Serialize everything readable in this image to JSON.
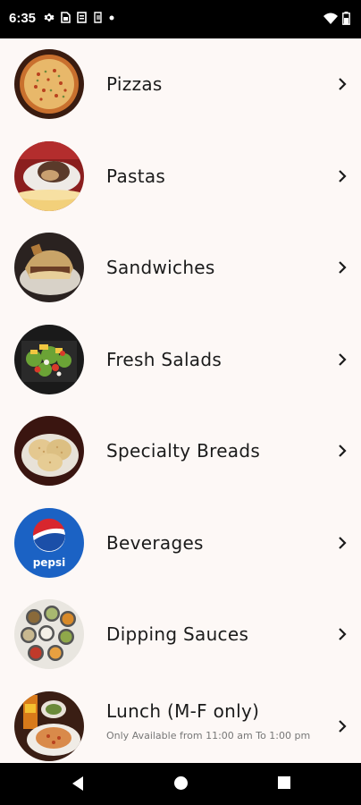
{
  "status_bar": {
    "time": "6:35",
    "left_icons": [
      "settings-icon",
      "sim-icon",
      "clipboard-icon",
      "data-icon",
      "dot-icon"
    ],
    "right_icons": [
      "wifi-icon",
      "battery-icon"
    ]
  },
  "menu": {
    "items": [
      {
        "label": "Pizzas",
        "image": "pizza-image"
      },
      {
        "label": "Pastas",
        "image": "pasta-image"
      },
      {
        "label": "Sandwiches",
        "image": "sandwich-image"
      },
      {
        "label": "Fresh Salads",
        "image": "salad-image"
      },
      {
        "label": "Specialty Breads",
        "image": "bread-image"
      },
      {
        "label": "Beverages",
        "image": "pepsi-logo-image"
      },
      {
        "label": "Dipping Sauces",
        "image": "sauces-image"
      },
      {
        "label": "Lunch (M-F only)",
        "subtitle": "Only Available from 11:00 am To 1:00 pm",
        "image": "lunch-image"
      }
    ]
  },
  "pepsi_logo_text": "pepsi",
  "nav_bar": {
    "buttons": [
      "back-icon",
      "home-icon",
      "recents-icon"
    ]
  },
  "colors": {
    "background": "#fdf8f6",
    "status_bar": "#000000",
    "text": "#1b1b1b",
    "subtitle": "#777777"
  }
}
